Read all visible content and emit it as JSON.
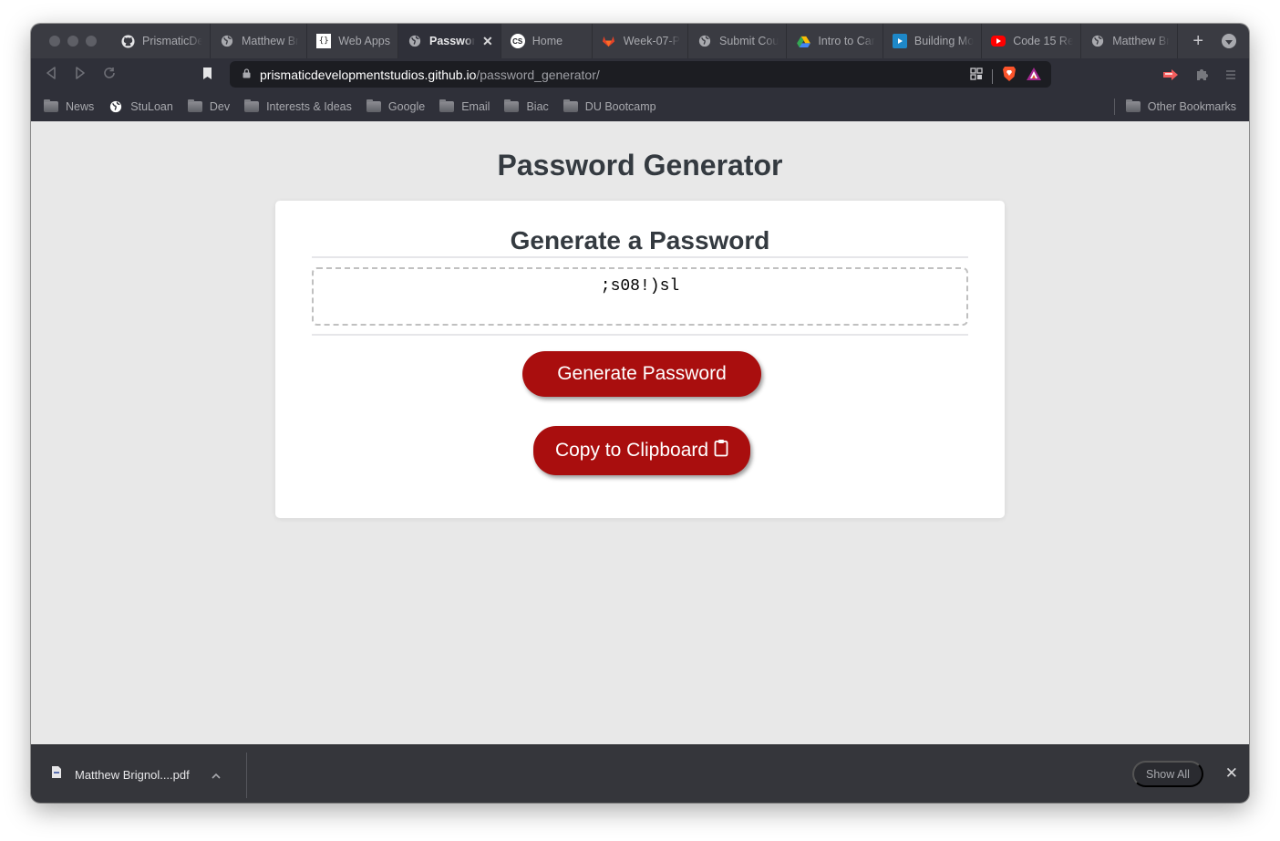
{
  "browser": {
    "tabs": [
      {
        "label": "PrismaticDe",
        "icon": "github-icon",
        "active": false
      },
      {
        "label": "Matthew Br",
        "icon": "globe-icon",
        "active": false
      },
      {
        "label": "Web Apps",
        "icon": "braces-icon",
        "active": false
      },
      {
        "label": "Passwor",
        "icon": "globe-icon",
        "active": true
      },
      {
        "label": "Home",
        "icon": "cs-icon",
        "active": false
      },
      {
        "label": "Week-07-P",
        "icon": "gitlab-icon",
        "active": false
      },
      {
        "label": "Submit Cou",
        "icon": "globe-icon",
        "active": false
      },
      {
        "label": "Intro to Car",
        "icon": "google-drive-icon",
        "active": false
      },
      {
        "label": "Building Mo",
        "icon": "video-icon",
        "active": false
      },
      {
        "label": "Code 15 Re",
        "icon": "youtube-icon",
        "active": false
      },
      {
        "label": "Matthew Br",
        "icon": "globe-icon",
        "active": false
      }
    ],
    "url": {
      "host": "prismaticdevelopmentstudios.github.io",
      "path": "/password_generator/"
    },
    "bookmarks": [
      {
        "label": "News",
        "icon": "folder-icon"
      },
      {
        "label": "StuLoan",
        "icon": "globe-icon"
      },
      {
        "label": "Dev",
        "icon": "folder-icon"
      },
      {
        "label": "Interests & Ideas",
        "icon": "folder-icon"
      },
      {
        "label": "Google",
        "icon": "folder-icon"
      },
      {
        "label": "Email",
        "icon": "folder-icon"
      },
      {
        "label": "Biac",
        "icon": "folder-icon"
      },
      {
        "label": "DU Bootcamp",
        "icon": "folder-icon"
      }
    ],
    "other_bookmarks": "Other Bookmarks"
  },
  "page": {
    "title": "Password Generator",
    "card_header": "Generate a Password",
    "password_value": ";s08!)sl",
    "generate_label": "Generate Password",
    "copy_label": "Copy to Clipboard",
    "accent_color": "#a90e0e"
  },
  "downloads": {
    "file_name": "Matthew Brignol....pdf",
    "show_all": "Show All"
  }
}
